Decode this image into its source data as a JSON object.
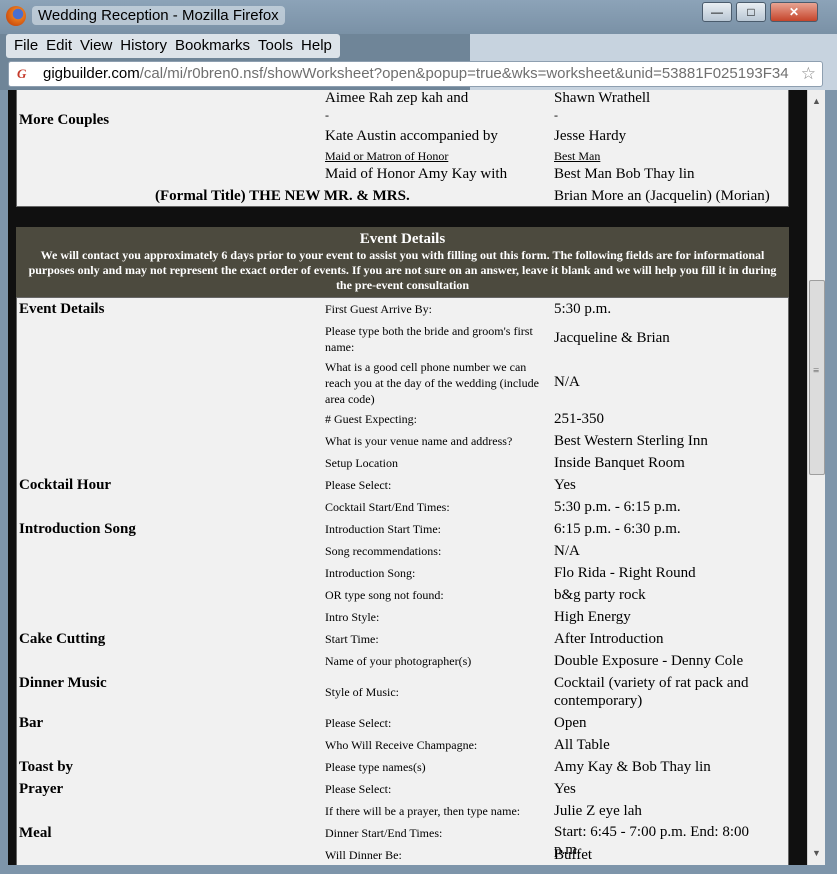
{
  "window": {
    "title": "Wedding Reception - Mozilla Firefox",
    "min_label": "—",
    "max_label": "□",
    "close_label": "✕"
  },
  "menu": [
    "File",
    "Edit",
    "View",
    "History",
    "Bookmarks",
    "Tools",
    "Help"
  ],
  "address": {
    "host": "gigbuilder.com",
    "path": "/cal/mi/r0bren0.nsf/showWorksheet?open&popup=true&wks=worksheet&unid=53881F025193F34",
    "favicon": "G"
  },
  "couples": {
    "section_label": "More Couples",
    "row1_left": "Aimee Rah zep kah and",
    "row1_right": "Shawn Wrathell",
    "dash_left": "-",
    "dash_right": "-",
    "row2_left": "Kate Austin accompanied by",
    "row2_right": "Jesse Hardy",
    "maid_label": "Maid or Matron of Honor",
    "bestman_label": "Best Man",
    "row3_left": "Maid of Honor Amy Kay with",
    "row3_right": "Best Man Bob Thay lin",
    "formal_label": "(Formal Title) THE NEW MR. & MRS.",
    "formal_value": "Brian More an (Jacquelin) (Morian)"
  },
  "event_header": {
    "title": "Event Details",
    "description": "We will contact you approximately 6 days prior to your event to assist you with filling out this form. The following fields are for informational purposes only and may not represent the exact order of events. If you are not sure on an answer, leave it blank and we will help you fill it in during the pre-event consultation"
  },
  "rows": [
    {
      "section": "Event Details",
      "q": "First Guest Arrive By:",
      "a": "5:30 p.m."
    },
    {
      "section": "",
      "q": "Please type both the bride and groom's first name:",
      "a": "Jacqueline & Brian"
    },
    {
      "section": "",
      "q": "What is a good cell phone number we can reach you at the day of the wedding (include area code)",
      "a": "N/A"
    },
    {
      "section": "",
      "q": "# Guest Expecting:",
      "a": "251-350"
    },
    {
      "section": "",
      "q": "What is your venue name and address?",
      "a": "Best Western Sterling Inn"
    },
    {
      "section": "",
      "q": "Setup Location",
      "a": "Inside Banquet Room"
    },
    {
      "section": "Cocktail Hour",
      "q": "Please Select:",
      "a": "Yes"
    },
    {
      "section": "",
      "q": "Cocktail Start/End Times:",
      "a": "5:30 p.m. - 6:15 p.m."
    },
    {
      "section": "Introduction Song",
      "q": "Introduction Start Time:",
      "a": "6:15 p.m. - 6:30 p.m."
    },
    {
      "section": "",
      "q": "Song recommendations:",
      "a": "N/A"
    },
    {
      "section": "",
      "q": "Introduction Song:",
      "a": "Flo Rida - Right Round"
    },
    {
      "section": "",
      "q": "OR type song not found:",
      "a": "b&g party rock"
    },
    {
      "section": "",
      "q": "Intro Style:",
      "a": "High Energy"
    },
    {
      "section": "Cake Cutting",
      "q": "Start Time:",
      "a": "After Introduction"
    },
    {
      "section": "",
      "q": "Name of your photographer(s)",
      "a": "Double Exposure - Denny Cole"
    },
    {
      "section": "Dinner Music",
      "q": "Style of Music:",
      "a": "Cocktail (variety of rat pack and contemporary)"
    },
    {
      "section": "Bar",
      "q": "Please Select:",
      "a": "Open"
    },
    {
      "section": "",
      "q": "Who Will Receive Champagne:",
      "a": "All Table"
    },
    {
      "section": "Toast by",
      "q": "Please type names(s)",
      "a": "Amy Kay & Bob Thay lin"
    },
    {
      "section": "Prayer",
      "q": "Please Select:",
      "a": "Yes"
    },
    {
      "section": "",
      "q": "If there will be a prayer, then type name:",
      "a": "Julie Z eye lah"
    },
    {
      "section": "Meal",
      "q": "Dinner Start/End Times:",
      "a": "Start: 6:45 - 7:00 p.m. End: 8:00 p.m."
    },
    {
      "section": "",
      "q": "Will Dinner Be:",
      "a": "Buffet"
    }
  ]
}
